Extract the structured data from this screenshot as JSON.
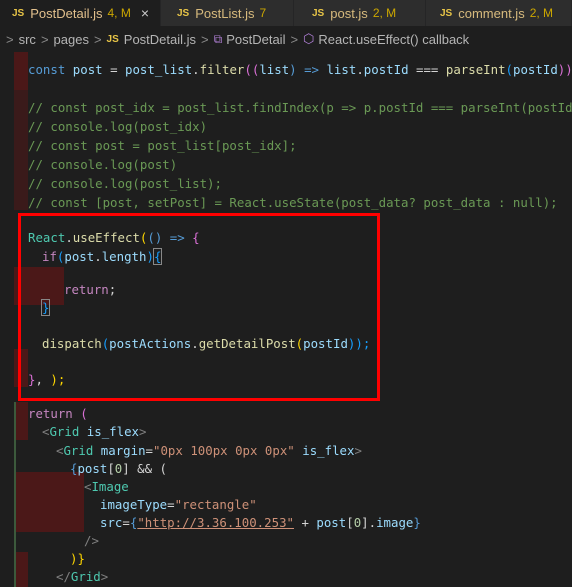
{
  "tabs": [
    {
      "name": "PostDetail.js",
      "badge": "4, M",
      "active": true,
      "close": "×"
    },
    {
      "name": "PostList.js",
      "badge": "7",
      "active": false
    },
    {
      "name": "post.js",
      "badge": "2, M",
      "active": false
    },
    {
      "name": "comment.js",
      "badge": "2, M",
      "active": false
    }
  ],
  "js_icon": "JS",
  "breadcrumb": {
    "src": "src",
    "pages": "pages",
    "file": "PostDetail.js",
    "component": "PostDetail",
    "callback": "React.useEffect() callback"
  },
  "code": {
    "l1": [
      "const",
      " ",
      "post",
      " = ",
      "post_list",
      ".",
      "filter",
      "((",
      "list",
      ") => ",
      "list",
      ".",
      "postId",
      " === ",
      "parseInt",
      "(",
      "postId",
      "));"
    ],
    "c1": "// const post_idx = post_list.findIndex(p => p.postId === parseInt(postId));",
    "c2": "// console.log(post_idx)",
    "c3": "// const post = post_list[post_idx];",
    "c4": "// console.log(post)",
    "c5": "// console.log(post_list);",
    "c6": "// const [post, setPost] = React.useState(post_data? post_data : null);",
    "u1": [
      "React",
      ".",
      "useEffect",
      "(",
      "() => ",
      "{"
    ],
    "u2": [
      "if",
      "(",
      "post",
      ".",
      "length",
      ")",
      "{"
    ],
    "u4": [
      "return",
      ";"
    ],
    "u5": "}",
    "u7": [
      "dispatch",
      "(",
      "postActions",
      ".",
      "getDetailPost",
      "(",
      "postId",
      "));"
    ],
    "u9": [
      "}",
      ", ",
      ");"
    ],
    "r1": [
      "return",
      " ("
    ],
    "r2": [
      "<",
      "Grid",
      " ",
      "is_flex",
      ">"
    ],
    "r3": [
      "<",
      "Grid",
      " ",
      "margin",
      "=",
      "\"0px 100px 0px 0px\"",
      " ",
      "is_flex",
      ">"
    ],
    "r4": [
      "{",
      "post",
      "[",
      "0",
      "] && ("
    ],
    "r5": [
      "<",
      "Image"
    ],
    "r6": [
      "imageType",
      "=",
      "\"rectangle\""
    ],
    "r7": [
      "src",
      "=",
      "{",
      "\"http://3.36.100.253\"",
      " + ",
      "post",
      "[",
      "0",
      "].",
      "image",
      "}"
    ],
    "r8": [
      "/>"
    ],
    "r9": [
      ")}"
    ],
    "r10": [
      "</",
      "Grid",
      ">"
    ]
  },
  "colors": {
    "highlight_box": "#ff0000",
    "gutter_error": "#4b1818"
  }
}
